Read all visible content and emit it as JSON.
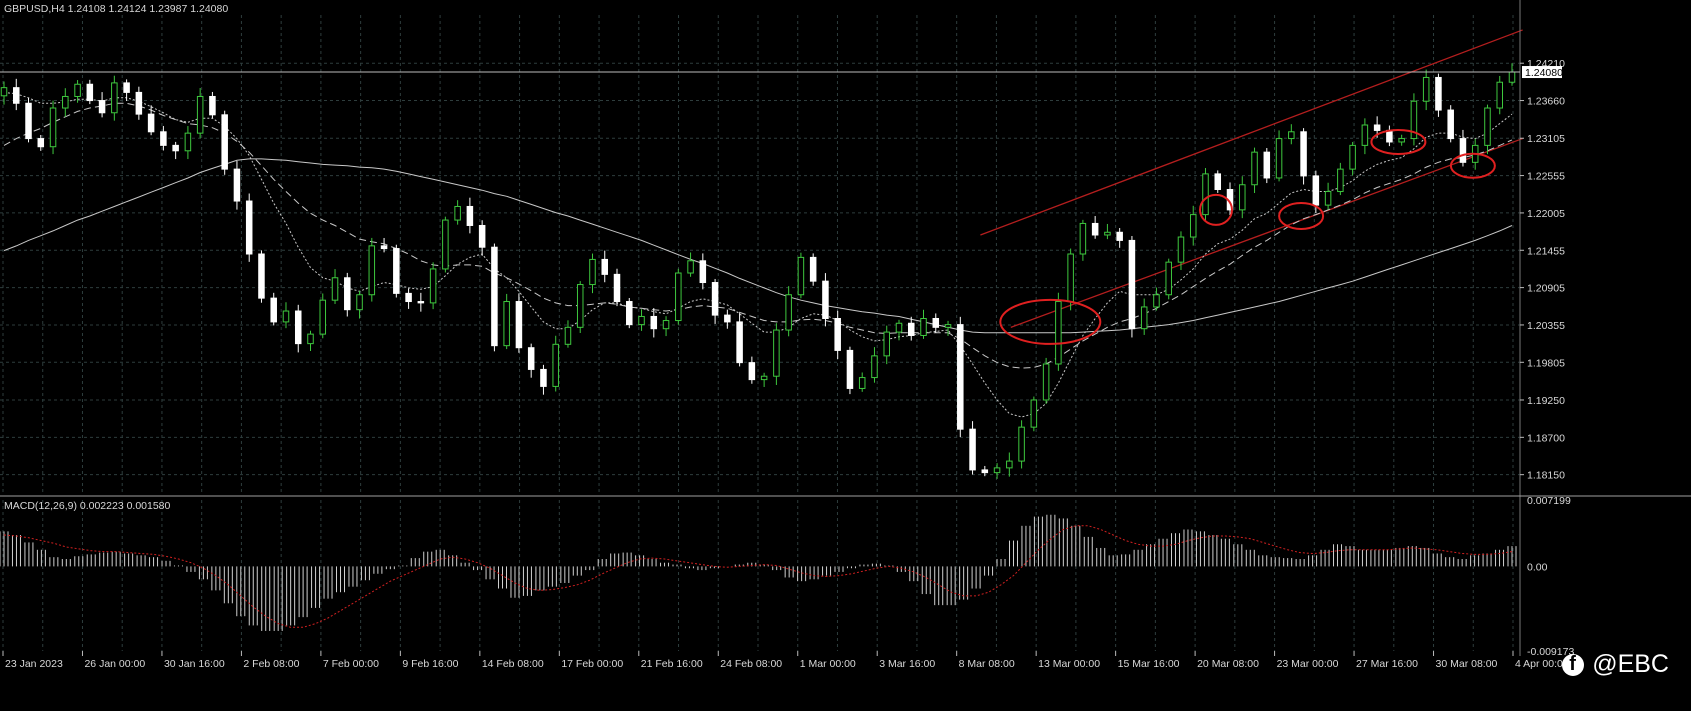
{
  "header": {
    "main_title": "GBPUSD,H4  1.24108 1.24124 1.23987 1.24080",
    "macd_title": "MACD(12,26,9) 0.002223 0.001580"
  },
  "watermark": {
    "text": "@EBC",
    "icon": "facebook-icon"
  },
  "colors": {
    "background": "#000000",
    "grid": "#2e3d3d",
    "bull_candle": "#3ec83e",
    "bear_candle": "#ffffff",
    "ma_line": "#c8c8c8",
    "channel": "#b41e1e",
    "ellipse": "#e02020",
    "macd_hist": "#d0d0d0",
    "macd_signal": "#d02020",
    "separator": "#a0a0a0"
  },
  "chart_data": {
    "type": "candlestick",
    "symbol": "GBPUSD",
    "timeframe": "H4",
    "last_price": 1.2408,
    "price_label": "1.24080",
    "ylim": [
      1.1788,
      1.2492
    ],
    "y_ticks": [
      "1.24210",
      "1.23660",
      "1.23105",
      "1.22555",
      "1.22005",
      "1.21455",
      "1.20905",
      "1.20355",
      "1.19805",
      "1.19250",
      "1.18700",
      "1.18150"
    ],
    "x_ticks": [
      "23 Jan 2023",
      "26 Jan 00:00",
      "30 Jan 16:00",
      "2 Feb 08:00",
      "7 Feb 00:00",
      "9 Feb 16:00",
      "14 Feb 08:00",
      "17 Feb 00:00",
      "21 Feb 16:00",
      "24 Feb 08:00",
      "1 Mar 00:00",
      "3 Mar 16:00",
      "8 Mar 08:00",
      "13 Mar 00:00",
      "15 Mar 16:00",
      "20 Mar 08:00",
      "23 Mar 00:00",
      "27 Mar 16:00",
      "30 Mar 08:00",
      "4 Apr 00:00"
    ],
    "closes": [
      1.2385,
      1.2362,
      1.231,
      1.2298,
      1.2355,
      1.2372,
      1.239,
      1.2366,
      1.2348,
      1.2392,
      1.2378,
      1.2346,
      1.232,
      1.23,
      1.2292,
      1.2318,
      1.2372,
      1.2345,
      1.2265,
      1.2218,
      1.214,
      1.2075,
      1.204,
      1.2056,
      1.2008,
      1.2022,
      1.2072,
      1.2105,
      1.2058,
      1.208,
      1.2152,
      1.2148,
      1.2082,
      1.207,
      1.2068,
      1.2118,
      1.219,
      1.221,
      1.2182,
      1.215,
      1.2005,
      1.207,
      1.2002,
      1.197,
      1.1945,
      1.2007,
      1.2032,
      1.2095,
      1.2132,
      1.211,
      1.207,
      1.2036,
      1.2048,
      1.203,
      1.2042,
      1.2112,
      1.213,
      1.2098,
      1.205,
      1.204,
      1.198,
      1.1955,
      1.196,
      1.2028,
      1.208,
      1.2135,
      1.21,
      1.2045,
      1.1998,
      1.1942,
      1.1958,
      1.199,
      1.2025,
      1.2038,
      1.202,
      1.2045,
      1.2032,
      1.2036,
      1.1882,
      1.1822,
      1.1818,
      1.1825,
      1.1835,
      1.1885,
      1.1925,
      1.1978,
      1.207,
      1.214,
      1.2185,
      1.2168,
      1.2172,
      1.216,
      1.203,
      1.2062,
      1.208,
      1.2128,
      1.2165,
      1.2198,
      1.2258,
      1.2235,
      1.2205,
      1.2242,
      1.229,
      1.2252,
      1.231,
      1.232,
      1.2255,
      1.2212,
      1.2232,
      1.2265,
      1.23,
      1.233,
      1.2322,
      1.2305,
      1.231,
      1.2365,
      1.24,
      1.2352,
      1.231,
      1.2275,
      1.23,
      1.2355,
      1.2393,
      1.2408
    ],
    "ma_fast": [
      1.2378,
      1.2376,
      1.237,
      1.2362,
      1.2362,
      1.2364,
      1.2368,
      1.2368,
      1.2365,
      1.237,
      1.237,
      1.2365,
      1.2357,
      1.2348,
      1.2338,
      1.2334,
      1.234,
      1.234,
      1.2328,
      1.231,
      1.2285,
      1.225,
      1.2215,
      1.2185,
      1.215,
      1.212,
      1.2105,
      1.21,
      1.209,
      1.2085,
      1.2092,
      1.2098,
      1.2095,
      1.209,
      1.2088,
      1.2092,
      1.2108,
      1.2125,
      1.2135,
      1.214,
      1.2118,
      1.2105,
      1.2085,
      1.2062,
      1.204,
      1.203,
      1.203,
      1.2042,
      1.2058,
      1.2068,
      1.2068,
      1.2062,
      1.206,
      1.2055,
      1.2052,
      1.206,
      1.207,
      1.2074,
      1.207,
      1.2065,
      1.2052,
      1.2038,
      1.2025,
      1.2025,
      1.2032,
      1.2045,
      1.2052,
      1.205,
      1.2042,
      1.2028,
      1.2018,
      1.2012,
      1.2014,
      1.2018,
      1.202,
      1.2024,
      1.2026,
      1.2028,
      1.2005,
      1.1978,
      1.195,
      1.1925,
      1.1905,
      1.19,
      1.1905,
      1.192,
      1.195,
      1.1985,
      1.202,
      1.2045,
      1.2068,
      1.2085,
      1.208,
      1.208,
      1.208,
      1.2088,
      1.2102,
      1.2118,
      1.214,
      1.2155,
      1.2162,
      1.2175,
      1.2192,
      1.22,
      1.2215,
      1.223,
      1.2235,
      1.2232,
      1.2232,
      1.2238,
      1.2248,
      1.2262,
      1.2272,
      1.2278,
      1.2282,
      1.2295,
      1.2312,
      1.2318,
      1.2318,
      1.2312,
      1.231,
      1.2318,
      1.2332,
      1.2346
    ],
    "ma_mid": [
      1.23,
      1.231,
      1.2318,
      1.2325,
      1.2334,
      1.2342,
      1.235,
      1.2355,
      1.2358,
      1.2362,
      1.2362,
      1.2358,
      1.2352,
      1.2344,
      1.2338,
      1.2332,
      1.233,
      1.2326,
      1.2318,
      1.2306,
      1.229,
      1.227,
      1.225,
      1.2232,
      1.2215,
      1.22,
      1.219,
      1.2182,
      1.2172,
      1.2162,
      1.2158,
      1.2155,
      1.2148,
      1.214,
      1.213,
      1.2124,
      1.2122,
      1.2124,
      1.2124,
      1.2122,
      1.2112,
      1.2105,
      1.2096,
      1.2086,
      1.2075,
      1.2068,
      1.2064,
      1.2064,
      1.2066,
      1.2068,
      1.2066,
      1.2062,
      1.206,
      1.2058,
      1.2056,
      1.2058,
      1.2062,
      1.2064,
      1.2062,
      1.206,
      1.2054,
      1.2048,
      1.2042,
      1.204,
      1.204,
      1.2043,
      1.2044,
      1.2042,
      1.2038,
      1.2032,
      1.2028,
      1.2024,
      1.2023,
      1.2024,
      1.2024,
      1.2024,
      1.2024,
      1.2024,
      1.2015,
      1.2002,
      1.199,
      1.198,
      1.1974,
      1.1972,
      1.1973,
      1.1978,
      1.1988,
      1.2,
      1.2012,
      1.2022,
      1.2032,
      1.204,
      1.2045,
      1.2052,
      1.206,
      1.207,
      1.208,
      1.2092,
      1.2104,
      1.2115,
      1.2125,
      1.2138,
      1.215,
      1.216,
      1.2172,
      1.2183,
      1.2192,
      1.2198,
      1.2205,
      1.2212,
      1.222,
      1.223,
      1.2238,
      1.2244,
      1.225,
      1.2258,
      1.2268,
      1.2275,
      1.228,
      1.2282,
      1.2286,
      1.2292,
      1.23,
      1.2308
    ],
    "ma_slow": [
      1.2145,
      1.2152,
      1.216,
      1.2167,
      1.2174,
      1.2182,
      1.219,
      1.2196,
      1.2203,
      1.221,
      1.2217,
      1.2224,
      1.2231,
      1.2238,
      1.2245,
      1.2252,
      1.226,
      1.2266,
      1.2272,
      1.2278,
      1.228,
      1.228,
      1.2279,
      1.2278,
      1.2276,
      1.2274,
      1.2272,
      1.2271,
      1.227,
      1.2268,
      1.2267,
      1.2265,
      1.2262,
      1.2258,
      1.2254,
      1.225,
      1.2246,
      1.2242,
      1.2238,
      1.2234,
      1.2229,
      1.2225,
      1.2219,
      1.2213,
      1.2207,
      1.2201,
      1.2196,
      1.219,
      1.2184,
      1.2178,
      1.2172,
      1.2166,
      1.216,
      1.2153,
      1.2146,
      1.2139,
      1.2132,
      1.2126,
      1.2119,
      1.2112,
      1.2104,
      1.2097,
      1.209,
      1.2083,
      1.2077,
      1.2072,
      1.2068,
      1.2064,
      1.2061,
      1.2058,
      1.2055,
      1.2053,
      1.205,
      1.2048,
      1.2044,
      1.204,
      1.2036,
      1.2032,
      1.2028,
      1.2025,
      1.2024,
      1.2024,
      1.2024,
      1.2024,
      1.2024,
      1.2024,
      1.2024,
      1.2024,
      1.2025,
      1.2026,
      1.2027,
      1.2028,
      1.203,
      1.2032,
      1.2034,
      1.2036,
      1.2039,
      1.2042,
      1.2046,
      1.205,
      1.2054,
      1.2058,
      1.2062,
      1.2066,
      1.207,
      1.2075,
      1.208,
      1.2085,
      1.209,
      1.2095,
      1.21,
      1.2106,
      1.2112,
      1.2118,
      1.2124,
      1.213,
      1.2136,
      1.2142,
      1.2148,
      1.2154,
      1.216,
      1.2167,
      1.2174,
      1.2182
    ],
    "channel": {
      "upper": [
        [
          0.645,
          1.2168
        ],
        [
          0.982,
          1.247
        ]
      ],
      "lower": [
        [
          0.665,
          1.2032
        ],
        [
          0.982,
          1.231
        ]
      ]
    },
    "highlight_ellipses": [
      [
        0.691,
        1.204
      ],
      [
        0.8,
        1.2205
      ],
      [
        0.856,
        1.2196
      ],
      [
        0.92,
        1.2305
      ],
      [
        0.969,
        1.227
      ]
    ],
    "macd": {
      "title": "MACD(12,26,9)",
      "main": 0.002223,
      "signal": 0.00158,
      "ylim": [
        -0.009173,
        0.007199
      ],
      "y_ticks": [
        "0.007199",
        "0.00",
        "-0.009173"
      ],
      "histogram": [
        0.0038,
        0.0034,
        0.0026,
        0.0018,
        0.001,
        0.0008,
        0.0011,
        0.0013,
        0.0015,
        0.0016,
        0.0014,
        0.0012,
        0.001,
        0.0006,
        0.0001,
        -0.0006,
        -0.0014,
        -0.0026,
        -0.004,
        -0.0054,
        -0.0064,
        -0.007,
        -0.007,
        -0.0064,
        -0.0055,
        -0.0045,
        -0.0035,
        -0.0028,
        -0.0022,
        -0.0015,
        -0.0008,
        -0.0003,
        0.0001,
        0.0009,
        0.0016,
        0.0018,
        0.0012,
        0.0004,
        -0.0004,
        -0.0014,
        -0.0024,
        -0.0034,
        -0.0032,
        -0.0026,
        -0.0022,
        -0.0018,
        -0.001,
        -0.0004,
        0.0008,
        0.0014,
        0.0015,
        0.0012,
        0.0008,
        0.0004,
        0.0002,
        -0.0002,
        -0.0004,
        -0.0002,
        0.0,
        0.0002,
        0.0004,
        0.0002,
        -0.0004,
        -0.0012,
        -0.0016,
        -0.0014,
        -0.001,
        -0.0006,
        -0.0002,
        0.0002,
        0.0003,
        0.0001,
        -0.0006,
        -0.0016,
        -0.003,
        -0.0042,
        -0.0042,
        -0.0036,
        -0.0024,
        -0.001,
        0.0008,
        0.0028,
        0.0044,
        0.0054,
        0.0056,
        0.0052,
        0.0044,
        0.0032,
        0.002,
        0.0012,
        0.0013,
        0.0018,
        0.0024,
        0.003,
        0.0036,
        0.004,
        0.0038,
        0.0034,
        0.003,
        0.0024,
        0.0018,
        0.0012,
        0.001,
        0.0009,
        0.0008,
        0.0012,
        0.0018,
        0.0024,
        0.0022,
        0.0018,
        0.0018,
        0.0018,
        0.002,
        0.0022,
        0.002,
        0.0014,
        0.001,
        0.0008,
        0.0012,
        0.0014,
        0.0018,
        0.0022
      ],
      "signal_line": [
        0.0034,
        0.0033,
        0.0031,
        0.0028,
        0.0025,
        0.0021,
        0.0019,
        0.0017,
        0.0016,
        0.0016,
        0.0015,
        0.0014,
        0.0013,
        0.0011,
        0.0008,
        0.0004,
        -0.0002,
        -0.001,
        -0.002,
        -0.0032,
        -0.0044,
        -0.0054,
        -0.0062,
        -0.0066,
        -0.0066,
        -0.0062,
        -0.0056,
        -0.0048,
        -0.004,
        -0.0032,
        -0.0024,
        -0.0016,
        -0.001,
        -0.0004,
        0.0002,
        0.0008,
        0.001,
        0.0008,
        0.0004,
        -0.0002,
        -0.001,
        -0.0018,
        -0.0024,
        -0.0026,
        -0.0025,
        -0.0023,
        -0.002,
        -0.0015,
        -0.0008,
        -0.0002,
        0.0004,
        0.0008,
        0.0009,
        0.0008,
        0.0006,
        0.0004,
        0.0002,
        0.0,
        -0.0001,
        0.0,
        0.0001,
        0.0002,
        0.0001,
        -0.0003,
        -0.0007,
        -0.001,
        -0.0011,
        -0.001,
        -0.0008,
        -0.0005,
        -0.0002,
        0.0,
        -0.0002,
        -0.0006,
        -0.0012,
        -0.002,
        -0.0028,
        -0.0032,
        -0.0032,
        -0.0028,
        -0.002,
        -0.001,
        0.0004,
        0.0018,
        0.003,
        0.004,
        0.0044,
        0.0044,
        0.004,
        0.0034,
        0.0028,
        0.0024,
        0.0022,
        0.0022,
        0.0024,
        0.0028,
        0.0031,
        0.0033,
        0.0033,
        0.0032,
        0.003,
        0.0026,
        0.0022,
        0.0018,
        0.0015,
        0.0014,
        0.0015,
        0.0017,
        0.0018,
        0.0018,
        0.0018,
        0.0018,
        0.0019,
        0.002,
        0.0019,
        0.0018,
        0.0016,
        0.0014,
        0.0013,
        0.0013,
        0.0014,
        0.0016
      ]
    }
  }
}
